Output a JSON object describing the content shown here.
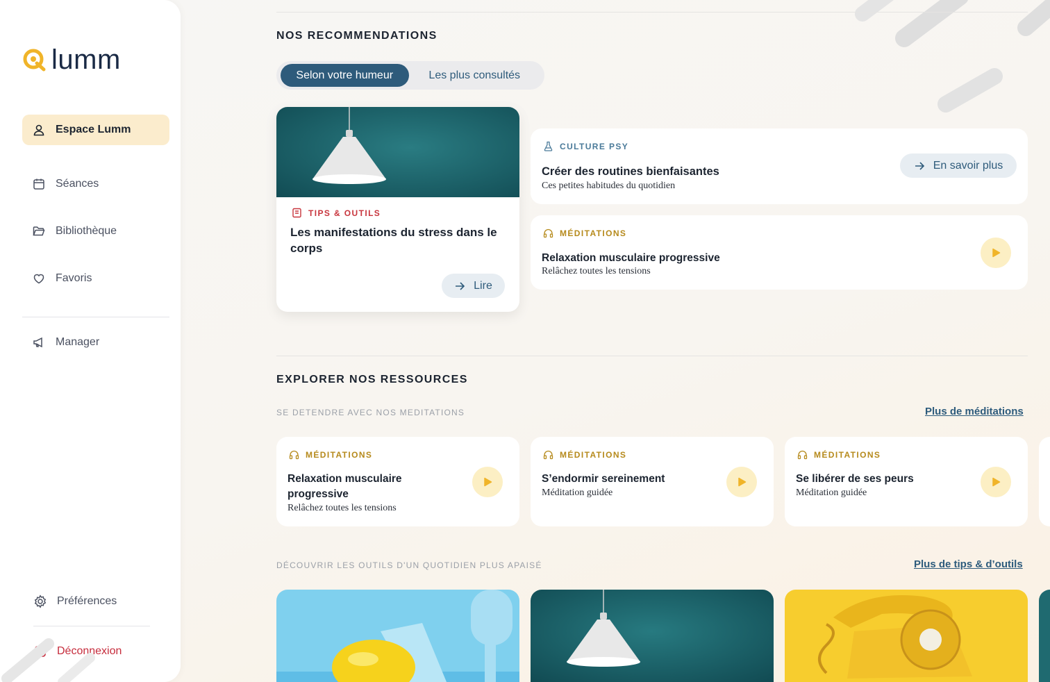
{
  "brand": {
    "name": "lumm",
    "accent": "#f0b429",
    "navy": "#1a2a45"
  },
  "sidebar": {
    "items": [
      {
        "label": "Espace Lumm",
        "icon": "user-icon",
        "active": true
      },
      {
        "label": "Séances",
        "icon": "calendar-icon"
      },
      {
        "label": "Bibliothèque",
        "icon": "folder-icon"
      },
      {
        "label": "Favoris",
        "icon": "heart-icon"
      },
      {
        "label": "Manager",
        "icon": "megaphone-icon"
      }
    ],
    "preferences": "Préférences",
    "logout": "Déconnexion"
  },
  "recommendations": {
    "title": "NOS RECOMMENDATIONS",
    "tabs": [
      "Selon votre humeur",
      "Les plus consultés"
    ],
    "featured": {
      "tag": "TIPS & OUTILS",
      "title": "Les manifestations du stress dans le corps",
      "button": "Lire"
    },
    "article": {
      "tag": "CULTURE PSY",
      "title": "Créer des routines bienfaisantes",
      "subtitle": "Ces petites habitudes du quotidien",
      "button": "En savoir plus"
    },
    "meditation": {
      "tag": "MÉDITATIONS",
      "title": "Relaxation musculaire progressive",
      "subtitle": "Relâchez toutes les tensions"
    }
  },
  "explore": {
    "title": "EXPLORER NOS RESSOURCES",
    "meditations_heading": "SE DETENDRE AVEC NOS MEDITATIONS",
    "meditations_link": "Plus de méditations",
    "meditations": [
      {
        "tag": "MÉDITATIONS",
        "title": "Relaxation musculaire progressive",
        "subtitle": "Relâchez toutes les tensions"
      },
      {
        "tag": "MÉDITATIONS",
        "title": "S’endormir sereinement",
        "subtitle": "Méditation guidée"
      },
      {
        "tag": "MÉDITATIONS",
        "title": "Se libérer de ses peurs",
        "subtitle": "Méditation guidée"
      }
    ],
    "tools_heading": "DÉCOUVRIR LES OUTILS D'UN QUOTIDIEN PLUS APAISÉ",
    "tools_link": "Plus de tips & d’outils"
  }
}
